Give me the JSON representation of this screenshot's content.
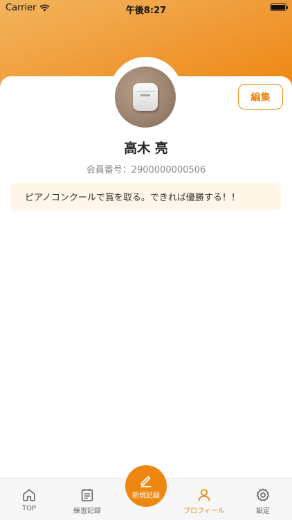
{
  "status_bar": {
    "carrier": "Carrier",
    "time": "午後8:27"
  },
  "profile": {
    "edit_label": "編集",
    "name": "高木 亮",
    "member_label": "会員番号：",
    "member_number": "2900000000506",
    "goal": "ピアノコンクールで賞を取る。できれば優勝する！！"
  },
  "tab_bar": {
    "top": "TOP",
    "practice_log": "練習記録",
    "new_record": "新規記録",
    "profile": "プロフィール",
    "settings": "設定"
  },
  "colors": {
    "accent": "#ee8711",
    "goal_background": "#fff6e7",
    "tab_inactive": "#666666"
  }
}
